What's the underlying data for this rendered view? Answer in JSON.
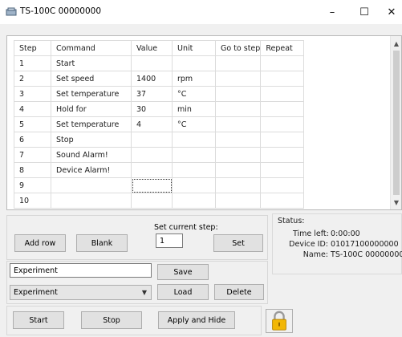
{
  "window": {
    "title": "TS-100C 00000000",
    "minimize_glyph": "–",
    "maximize_glyph": "☐",
    "close_glyph": "✕"
  },
  "grid": {
    "columns": [
      "Step",
      "Command",
      "Value",
      "Unit",
      "Go to step",
      "Repeat"
    ],
    "rows": [
      [
        "1",
        "Start",
        "",
        "",
        "",
        ""
      ],
      [
        "2",
        "Set speed",
        "1400",
        "rpm",
        "",
        ""
      ],
      [
        "3",
        "Set temperature",
        "37",
        "°C",
        "",
        ""
      ],
      [
        "4",
        "Hold for",
        "30",
        "min",
        "",
        ""
      ],
      [
        "5",
        "Set temperature",
        "4",
        "°C",
        "",
        ""
      ],
      [
        "6",
        "Stop",
        "",
        "",
        "",
        ""
      ],
      [
        "7",
        "Sound Alarm!",
        "",
        "",
        "",
        ""
      ],
      [
        "8",
        "Device Alarm!",
        "",
        "",
        "",
        ""
      ],
      [
        "9",
        "",
        "",
        "",
        "",
        ""
      ],
      [
        "10",
        "",
        "",
        "",
        "",
        ""
      ]
    ]
  },
  "controls": {
    "add_row": "Add row",
    "blank": "Blank",
    "set_current_step_label": "Set current step:",
    "current_step_value": "1",
    "set": "Set",
    "experiment_name_value": "Experiment",
    "save": "Save",
    "experiment_select_value": "Experiment",
    "load": "Load",
    "delete": "Delete",
    "start": "Start",
    "stop": "Stop",
    "apply_and_hide": "Apply and Hide"
  },
  "status": {
    "title": "Status:",
    "time_left_label": "Time left:",
    "time_left_value": "0:00:00",
    "device_id_label": "Device ID:",
    "device_id_value": "01017100000000",
    "name_label": "Name:",
    "name_value": "TS-100C 00000000"
  },
  "icons": {
    "app": "device-icon",
    "lock": "padlock-icon",
    "lock_color": "#f2b705"
  }
}
